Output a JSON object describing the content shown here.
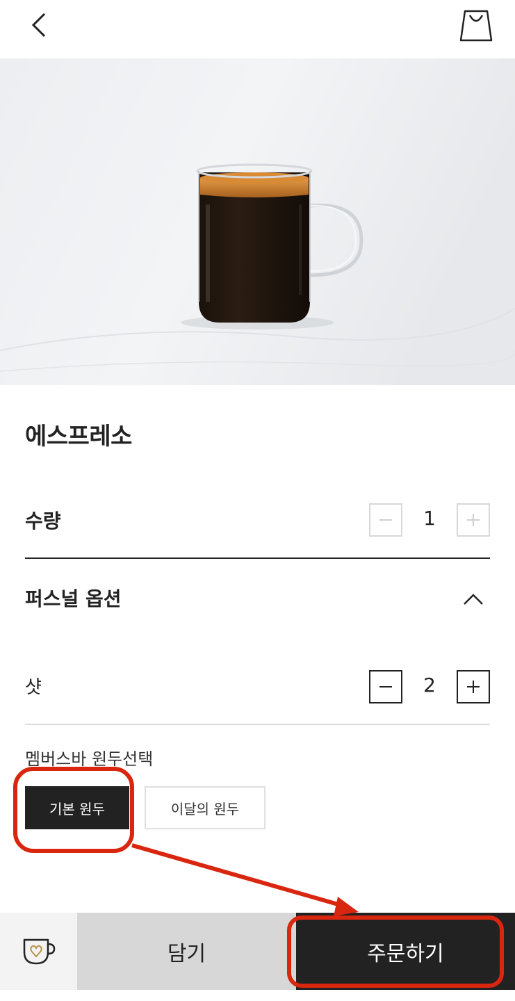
{
  "header": {
    "back_icon": "chevron-left-icon",
    "cart_icon": "shopping-bag-icon"
  },
  "hero": {
    "image": "espresso-glass-mug"
  },
  "product": {
    "title": "에스프레소"
  },
  "quantity": {
    "label": "수량",
    "value": "1",
    "minus_icon": "minus-icon",
    "plus_icon": "plus-icon"
  },
  "personal_option": {
    "label": "퍼스널 옵션",
    "toggle_icon": "chevron-up-icon"
  },
  "shot": {
    "label": "샷",
    "value": "2"
  },
  "bean": {
    "label": "멤버스바 원두선택",
    "options": [
      "기본 원두",
      "이달의 원두"
    ],
    "selected": "기본 원두"
  },
  "bottom": {
    "favorite_icon": "heart-cup-icon",
    "add_label": "담기",
    "order_label": "주문하기"
  },
  "colors": {
    "dark": "#222222",
    "annotation_red": "#d9260f",
    "accent_gold": "#b8944e"
  }
}
